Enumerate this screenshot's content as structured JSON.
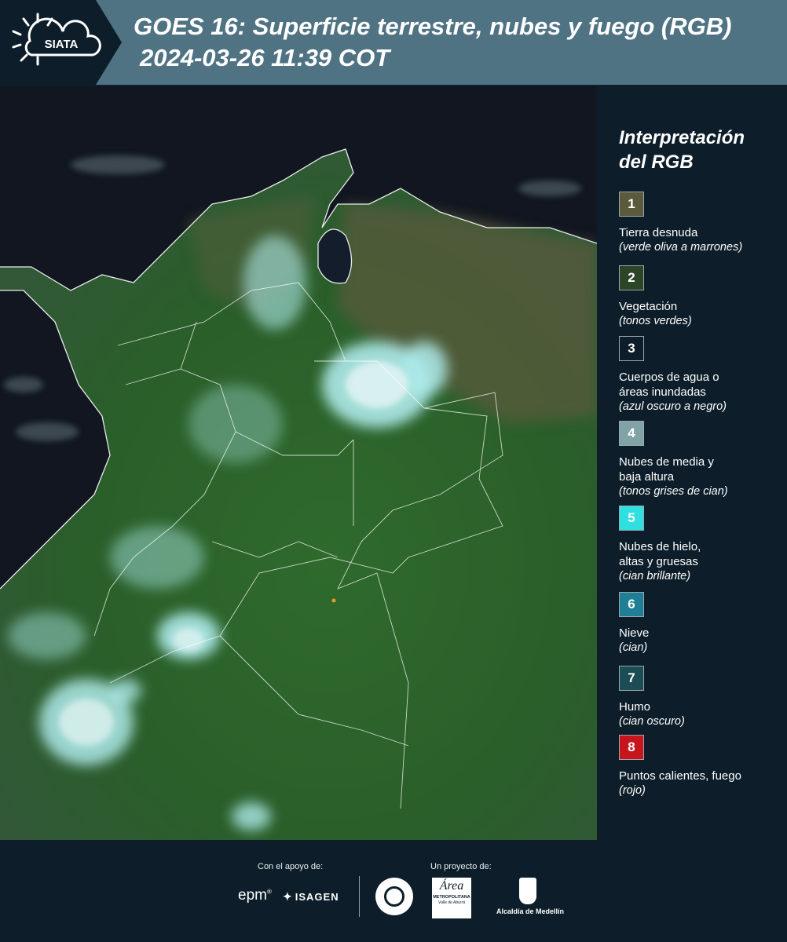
{
  "header": {
    "logo_text": "SIATA",
    "title": "GOES 16: Superficie terrestre, nubes y fuego (RGB)",
    "timestamp": "2024-03-26 11:39 COT"
  },
  "legend": {
    "title_line1": "Interpretación",
    "title_line2": "del RGB",
    "items": [
      {
        "num": "1",
        "color": "#5b5a3c",
        "label": "Tierra desnuda",
        "sub": "(verde oliva a marrones)"
      },
      {
        "num": "2",
        "color": "#2c4526",
        "label": "Vegetación",
        "sub": "(tonos verdes)"
      },
      {
        "num": "3",
        "color": "#0d1e2a",
        "label": "Cuerpos de agua o",
        "label2": "áreas inundadas",
        "sub": "(azul oscuro a negro)"
      },
      {
        "num": "4",
        "color": "#7fa3a6",
        "label": "Nubes de media y",
        "label2": "baja altura",
        "sub": "(tonos grises de cian)"
      },
      {
        "num": "5",
        "color": "#2ee0e0",
        "label": "Nubes de hielo,",
        "label2": "altas y gruesas",
        "sub": "(cian brillante)"
      },
      {
        "num": "6",
        "color": "#1e7f97",
        "label": "Nieve",
        "sub": "(cian)"
      },
      {
        "num": "7",
        "color": "#1d4d54",
        "label": "Humo",
        "sub": "(cian oscuro)"
      },
      {
        "num": "8",
        "color": "#c8141c",
        "label": "Puntos calientes, fuego",
        "sub": "(rojo)"
      }
    ]
  },
  "footer": {
    "support_label": "Con el apoyo de:",
    "project_label": "Un proyecto de:",
    "epm": "epm",
    "isagen": "ISAGEN",
    "area_name": "Área",
    "area_sub1": "METROPOLITANA",
    "area_sub2": "Valle de Aburrá",
    "alcaldia": "Alcaldía de Medellín"
  }
}
